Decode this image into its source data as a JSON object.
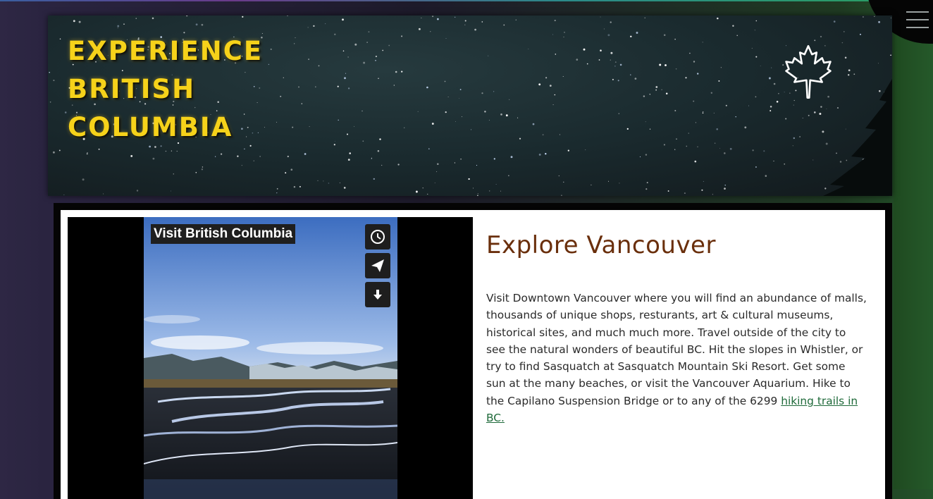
{
  "header": {
    "title_lines": [
      "EXPERIENCE",
      "BRITISH",
      "COLUMBIA"
    ],
    "logo": "maple-leaf-icon"
  },
  "nav": {
    "menu_icon": "hamburger-menu-icon"
  },
  "video": {
    "title": "Visit British Columbia",
    "buttons": [
      "clock-icon",
      "share-plane-icon",
      "download-icon"
    ]
  },
  "article": {
    "heading": "Explore Vancouver",
    "body": "Visit Downtown Vancouver where you will find an abundance of malls, thousands of unique shops, resturants, art & cultural museums, historical sites, and much much more. Travel outside of the city to see the natural wonders of beautiful BC. Hit the slopes in Whistler, or try to find Sasquatch at Sasquatch Mountain Ski Resort. Get some sun at the many beaches, or visit the Vancouver Aquarium. Hike to the Capilano Suspension Bridge or to any of the 6299 ",
    "link_text": "hiking trails in BC."
  },
  "colors": {
    "title": "#f6d21a",
    "heading": "#6a2f0c",
    "link": "#1f6a3a"
  }
}
